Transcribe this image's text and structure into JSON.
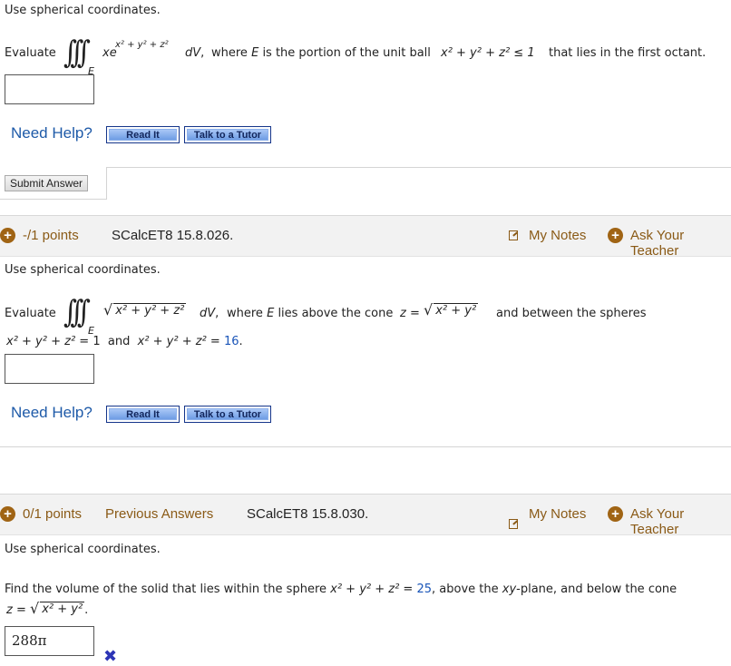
{
  "q1": {
    "instruction": "Use spherical coordinates.",
    "evaluate_label": "Evaluate",
    "integrand_base": "xe",
    "exponent": "x² + y² + z²",
    "dv": "dV,",
    "text_where": "where",
    "text_e": "E",
    "text_region": "is the portion of the unit ball",
    "ball_ineq": "x² + y² + z² ≤ 1",
    "text_tail": "that lies in the first octant.",
    "answer_value": "",
    "need_help": "Need Help?",
    "read_it": "Read It",
    "talk_tutor": "Talk to a Tutor",
    "submit": "Submit Answer"
  },
  "q2": {
    "points": "-/1 points",
    "question_id": "SCalcET8 15.8.026.",
    "my_notes": "My Notes",
    "ask_teacher": "Ask Your Teacher",
    "instruction": "Use spherical coordinates.",
    "evaluate_label": "Evaluate",
    "integrand": "x² + y² + z²",
    "dv": "dV,",
    "text_where": "where",
    "text_e": "E",
    "text_mid": "lies above the cone",
    "cone_lhs": "z =",
    "cone_rad": "x² + y²",
    "text_between": "and between the spheres",
    "sphere1_lhs": "x² + y² + z² =",
    "sphere1_rhs": "1",
    "text_and": "and",
    "sphere2_lhs": "x² + y² + z² =",
    "sphere2_rhs": "16",
    "period": ".",
    "answer_value": "",
    "need_help": "Need Help?",
    "read_it": "Read It",
    "talk_tutor": "Talk to a Tutor"
  },
  "q3": {
    "points": "0/1 points",
    "previous_answers": "Previous Answers",
    "question_id": "SCalcET8 15.8.030.",
    "my_notes": "My Notes",
    "ask_teacher": "Ask Your Teacher",
    "instruction": "Use spherical coordinates.",
    "text_a": "Find the volume of the solid that lies within the sphere",
    "sphere_lhs": "x² + y² + z² =",
    "sphere_rhs": "25",
    "text_b": ", above the",
    "plane": "xy",
    "text_c": "-plane, and below the cone",
    "cone_lhs": "z =",
    "cone_rad": "x² + y²",
    "period": ".",
    "answer_value": "288π",
    "answer_status": "incorrect"
  },
  "colors": {
    "link_blue": "#1e5aa8",
    "accent_brown": "#8a5a16",
    "plus_brown": "#a06414",
    "header_bg": "#f2f2f2",
    "wrong_mark": "#2d35b6"
  },
  "icons": [
    "plus-circle-icon",
    "notes-icon",
    "x-mark-icon"
  ]
}
